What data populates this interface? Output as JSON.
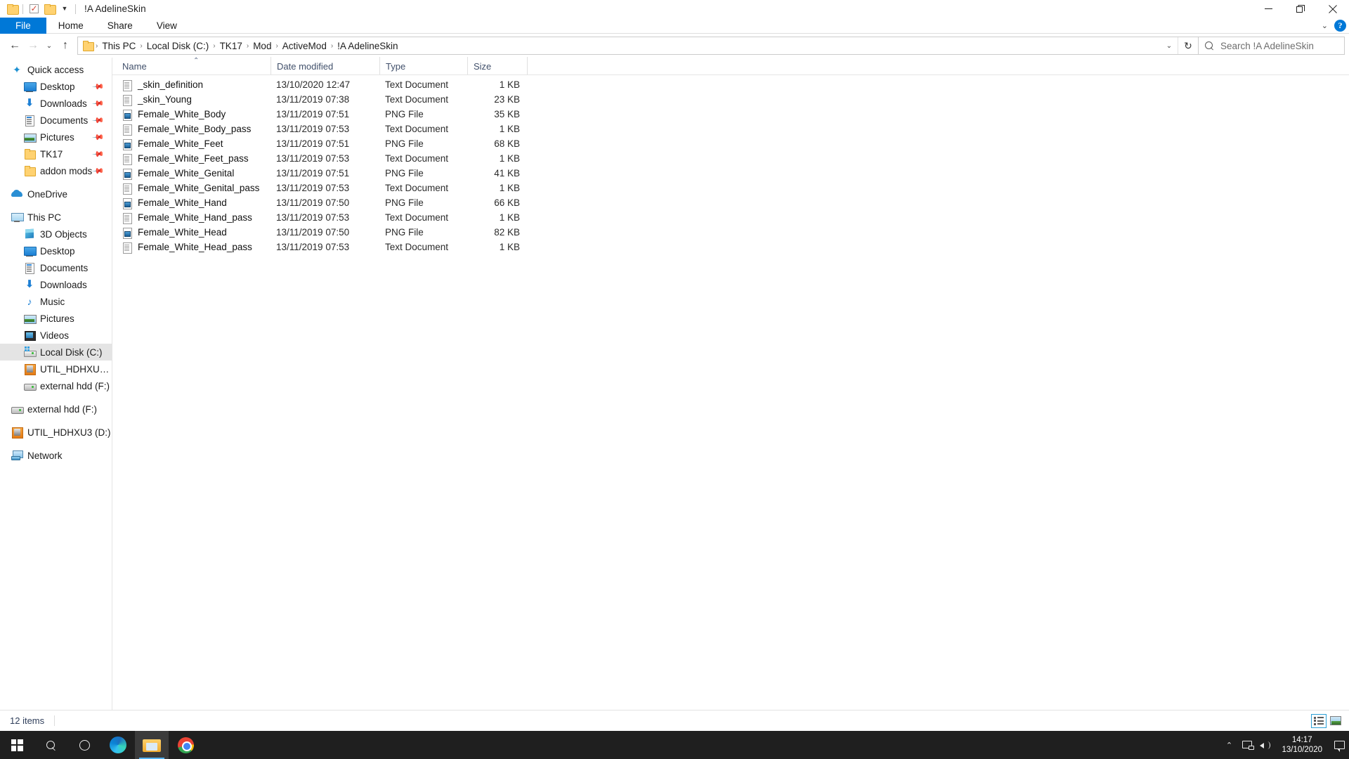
{
  "window": {
    "title": "!A AdelineSkin",
    "quick_access_icons": [
      "folder-icon",
      "properties-icon",
      "new-folder-icon",
      "customize-dropdown-icon"
    ],
    "controls": {
      "minimize": "minimize-button",
      "maximize": "maximize-button",
      "close": "close-button"
    }
  },
  "ribbon": {
    "tabs": [
      {
        "label": "File",
        "active": true
      },
      {
        "label": "Home",
        "active": false
      },
      {
        "label": "Share",
        "active": false
      },
      {
        "label": "View",
        "active": false
      }
    ],
    "expand_label": "⌄",
    "help_label": "?"
  },
  "address": {
    "back": "←",
    "forward": "→",
    "recent": "⌄",
    "up": "↑",
    "crumbs": [
      "This PC",
      "Local Disk (C:)",
      "TK17",
      "Mod",
      "ActiveMod",
      "!A AdelineSkin"
    ],
    "separator": "›",
    "dropdown": "⌄",
    "refresh": "↻"
  },
  "search": {
    "placeholder": "Search !A AdelineSkin",
    "value": ""
  },
  "nav_pane": {
    "groups": [
      {
        "header": {
          "label": "Quick access",
          "icon": "star-pin-icon",
          "level": "root",
          "selected": false
        },
        "items": [
          {
            "label": "Desktop",
            "icon": "desktop-icon",
            "level": "child",
            "pinned": true
          },
          {
            "label": "Downloads",
            "icon": "download-icon",
            "level": "child",
            "pinned": true
          },
          {
            "label": "Documents",
            "icon": "documents-icon",
            "level": "child",
            "pinned": true
          },
          {
            "label": "Pictures",
            "icon": "pictures-icon",
            "level": "child",
            "pinned": true
          },
          {
            "label": "TK17",
            "icon": "folder-icon",
            "level": "child",
            "pinned": true
          },
          {
            "label": "addon mods",
            "icon": "folder-icon",
            "level": "child",
            "pinned": true
          }
        ]
      },
      {
        "header": {
          "label": "OneDrive",
          "icon": "onedrive-cloud-icon",
          "level": "root",
          "selected": false
        },
        "items": []
      },
      {
        "header": {
          "label": "This PC",
          "icon": "this-pc-icon",
          "level": "root",
          "selected": false
        },
        "items": [
          {
            "label": "3D Objects",
            "icon": "3d-objects-icon",
            "level": "child",
            "pinned": false
          },
          {
            "label": "Desktop",
            "icon": "desktop-icon",
            "level": "child",
            "pinned": false
          },
          {
            "label": "Documents",
            "icon": "documents-icon",
            "level": "child",
            "pinned": false
          },
          {
            "label": "Downloads",
            "icon": "download-icon",
            "level": "child",
            "pinned": false
          },
          {
            "label": "Music",
            "icon": "music-icon",
            "level": "child",
            "pinned": false
          },
          {
            "label": "Pictures",
            "icon": "pictures-icon",
            "level": "child",
            "pinned": false
          },
          {
            "label": "Videos",
            "icon": "videos-icon",
            "level": "child",
            "pinned": false
          },
          {
            "label": "Local Disk (C:)",
            "icon": "local-disk-icon",
            "level": "child",
            "pinned": false,
            "selected": true
          },
          {
            "label": "UTIL_HDHXU3 (D:)",
            "icon": "usb-drive-icon",
            "level": "child",
            "pinned": false
          },
          {
            "label": "external hdd (F:)",
            "icon": "external-hdd-icon",
            "level": "child",
            "pinned": false
          }
        ]
      },
      {
        "header": {
          "label": "external hdd (F:)",
          "icon": "external-hdd-icon",
          "level": "root",
          "selected": false
        },
        "items": []
      },
      {
        "header": {
          "label": "UTIL_HDHXU3 (D:)",
          "icon": "usb-drive-icon",
          "level": "root",
          "selected": false
        },
        "items": []
      },
      {
        "header": {
          "label": "Network",
          "icon": "network-icon",
          "level": "root",
          "selected": false
        },
        "items": []
      }
    ]
  },
  "file_list": {
    "columns": [
      {
        "key": "name",
        "label": "Name",
        "sorted": true,
        "sort_dir": "asc"
      },
      {
        "key": "date",
        "label": "Date modified",
        "sorted": false
      },
      {
        "key": "type",
        "label": "Type",
        "sorted": false
      },
      {
        "key": "size",
        "label": "Size",
        "sorted": false
      }
    ],
    "sort_indicator": "⌃",
    "rows": [
      {
        "name": "_skin_definition",
        "date": "13/10/2020 12:47",
        "type": "Text Document",
        "size": "1 KB",
        "icon": "text-file-icon"
      },
      {
        "name": "_skin_Young",
        "date": "13/11/2019 07:38",
        "type": "Text Document",
        "size": "23 KB",
        "icon": "text-file-icon"
      },
      {
        "name": "Female_White_Body",
        "date": "13/11/2019 07:51",
        "type": "PNG File",
        "size": "35 KB",
        "icon": "png-file-icon"
      },
      {
        "name": "Female_White_Body_pass",
        "date": "13/11/2019 07:53",
        "type": "Text Document",
        "size": "1 KB",
        "icon": "text-file-icon"
      },
      {
        "name": "Female_White_Feet",
        "date": "13/11/2019 07:51",
        "type": "PNG File",
        "size": "68 KB",
        "icon": "png-file-icon"
      },
      {
        "name": "Female_White_Feet_pass",
        "date": "13/11/2019 07:53",
        "type": "Text Document",
        "size": "1 KB",
        "icon": "text-file-icon"
      },
      {
        "name": "Female_White_Genital",
        "date": "13/11/2019 07:51",
        "type": "PNG File",
        "size": "41 KB",
        "icon": "png-file-icon"
      },
      {
        "name": "Female_White_Genital_pass",
        "date": "13/11/2019 07:53",
        "type": "Text Document",
        "size": "1 KB",
        "icon": "text-file-icon"
      },
      {
        "name": "Female_White_Hand",
        "date": "13/11/2019 07:50",
        "type": "PNG File",
        "size": "66 KB",
        "icon": "png-file-icon"
      },
      {
        "name": "Female_White_Hand_pass",
        "date": "13/11/2019 07:53",
        "type": "Text Document",
        "size": "1 KB",
        "icon": "text-file-icon"
      },
      {
        "name": "Female_White_Head",
        "date": "13/11/2019 07:50",
        "type": "PNG File",
        "size": "82 KB",
        "icon": "png-file-icon"
      },
      {
        "name": "Female_White_Head_pass",
        "date": "13/11/2019 07:53",
        "type": "Text Document",
        "size": "1 KB",
        "icon": "text-file-icon"
      }
    ]
  },
  "status_bar": {
    "item_count": "12 items",
    "view_buttons": [
      {
        "name": "details-view-button",
        "active": true
      },
      {
        "name": "large-icons-view-button",
        "active": false
      }
    ]
  },
  "taskbar": {
    "items": [
      {
        "name": "start-button",
        "icon": "windows-logo-icon",
        "active": false
      },
      {
        "name": "search-taskbar",
        "icon": "search-icon",
        "active": false
      },
      {
        "name": "cortana-button",
        "icon": "circle-icon",
        "active": false
      },
      {
        "name": "edge-button",
        "icon": "edge-icon",
        "active": false
      },
      {
        "name": "file-explorer-button",
        "icon": "file-explorer-icon",
        "active": true
      },
      {
        "name": "chrome-button",
        "icon": "chrome-icon",
        "active": false
      }
    ],
    "tray": {
      "chevron": "⌃",
      "icons": [
        "network-icon",
        "volume-icon"
      ],
      "time": "14:17",
      "date": "13/10/2020",
      "action_center": "notification-icon"
    }
  },
  "colors": {
    "accent": "#0078d7",
    "taskbar_bg": "#1f1f1f",
    "selection": "#e4e4e4",
    "header_text": "#41506b",
    "folder_yellow": "#ffd271"
  }
}
